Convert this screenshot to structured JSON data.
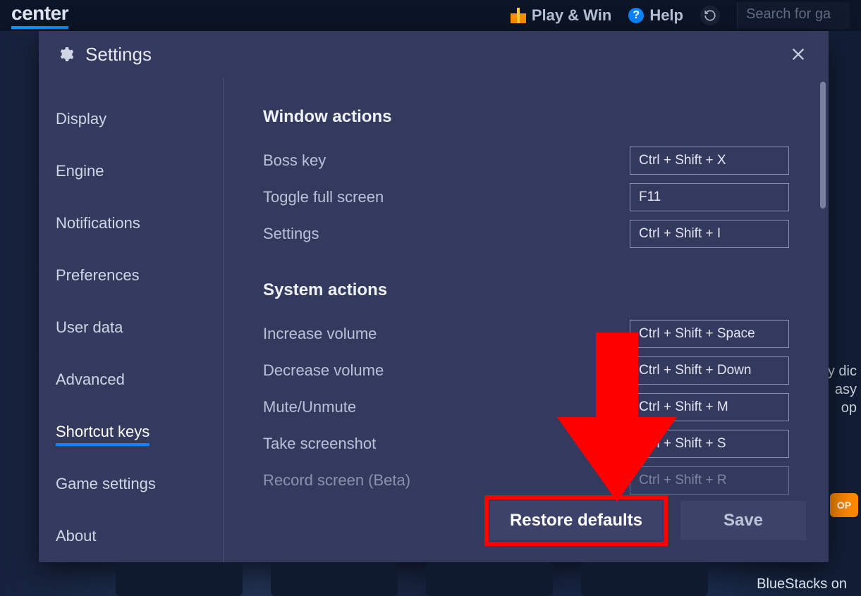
{
  "topbar": {
    "brand_fragment": "center",
    "play_win": "Play & Win",
    "help": "Help",
    "search_placeholder": "Search for ga"
  },
  "modal": {
    "title": "Settings",
    "close_aria": "Close"
  },
  "sidebar": {
    "items": [
      {
        "label": "Display"
      },
      {
        "label": "Engine"
      },
      {
        "label": "Notifications"
      },
      {
        "label": "Preferences"
      },
      {
        "label": "User data"
      },
      {
        "label": "Advanced"
      },
      {
        "label": "Shortcut keys",
        "active": true
      },
      {
        "label": "Game settings"
      },
      {
        "label": "About"
      }
    ]
  },
  "sections": {
    "window": {
      "title": "Window actions",
      "rows": [
        {
          "label": "Boss key",
          "shortcut": "Ctrl + Shift + X"
        },
        {
          "label": "Toggle full screen",
          "shortcut": "F11"
        },
        {
          "label": "Settings",
          "shortcut": "Ctrl + Shift + I"
        }
      ]
    },
    "system": {
      "title": "System actions",
      "rows": [
        {
          "label": "Increase volume",
          "shortcut": "Ctrl + Shift + Space"
        },
        {
          "label": "Decrease volume",
          "shortcut": "Ctrl + Shift + Down"
        },
        {
          "label": "Mute/Unmute",
          "shortcut": "Ctrl + Shift + M"
        },
        {
          "label": "Take screenshot",
          "shortcut": "Ctrl + Shift + S"
        },
        {
          "label": "Record screen (Beta)",
          "shortcut": "Ctrl + Shift + R",
          "faded": true
        }
      ]
    }
  },
  "footer": {
    "restore": "Restore defaults",
    "save": "Save"
  },
  "bg": {
    "top_badge": "OP",
    "right_text_1": "y dic",
    "right_text_2": "asy",
    "right_text_3": "op",
    "peek_text": "BlueStacks on"
  }
}
